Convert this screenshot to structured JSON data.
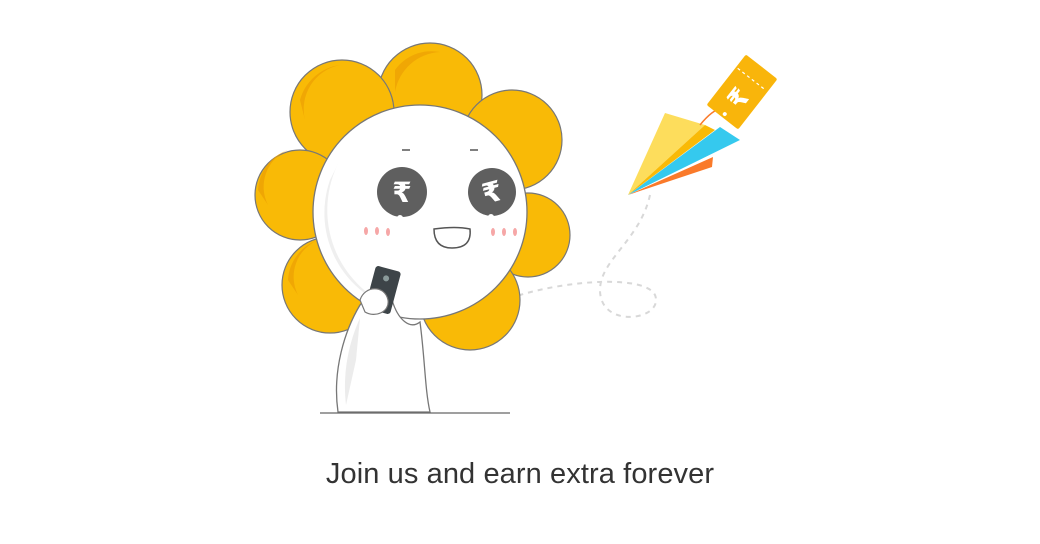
{
  "illustration": {
    "description_icons": [
      "sunflower-mascot",
      "paper-plane-icon",
      "rupee-ticket-icon"
    ],
    "colors": {
      "petal": "#F9BA06",
      "petal_shade": "#EDA204",
      "eye": "#5F5F5F",
      "plane_yellow": "#FDDD5C",
      "plane_blue": "#35C9EE",
      "plane_orange": "#FA7A2A",
      "ticket": "#F9B50B"
    },
    "currency_symbol": "₹"
  },
  "tagline": "Join us and earn extra forever"
}
